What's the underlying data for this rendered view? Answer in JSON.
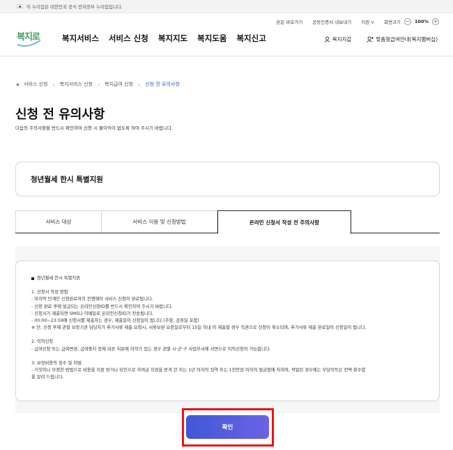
{
  "gov_bar": {
    "text": "이 누리집은 대한민국 공식 전자정부 누리집입니다."
  },
  "utility": {
    "links": [
      "본문 바로가기",
      "공동인증서 내보내기",
      "지원 ∨",
      "화면크기"
    ],
    "zoom_value": "100%",
    "zoom_minus": "−",
    "zoom_plus": "+"
  },
  "logo": {
    "text": "복지로"
  },
  "nav": {
    "items": [
      "복지서비스",
      "서비스 신청",
      "복지지도",
      "복지도움",
      "복지신고"
    ]
  },
  "right_nav": {
    "items": [
      "복지지갑",
      "맞춤형급여안내(복지멤버십)"
    ]
  },
  "breadcrumb": {
    "items": [
      "서비스 신청",
      "복지서비스 신청",
      "복지급여 신청",
      "신청 전 유의사항"
    ]
  },
  "page": {
    "title": "신청 전 유의사항",
    "subtitle": "다음의 주의사항을 반드시 확인하여 신청 시 불이익이 없도록 하여 주시기 바랍니다."
  },
  "service_name": "청년월세 한시 특별지원",
  "tabs": [
    "서비스 대상",
    "서비스 이용 및 신청방법",
    "온라인 신청서 작성 전 주의사항"
  ],
  "notice": {
    "heading": "청년월세 한시 특별지원",
    "sections": [
      {
        "title": "1. 신청서 작성 방법",
        "lines": [
          "- 마지막 단계인 신청완료까지 진행해야 서비스 신청이 완료됩니다.",
          "- 신청 완료 후에 발급되는 온라인신청ID를 반드시 확인하여 주시기 바랍니다.",
          "- 신청서가 제출되면 SMS나 이메일로 온라인신청ID가 전송됩니다.",
          "- 00:00~23:59에 신청서를 제출하는 경우, 제출일이 신청일이 됩니다.(주말, 공휴일 포함)",
          "※ 단, 신청 후에 관할 보장기관 담당자가 추가서류 제출 요청시, 서류보완 요청일로부터 15일 이내 미 제출할 경우 직권으로 신청이 취소되며, 추가서류 제출 완료일이 신청일이 됩니다."
        ]
      },
      {
        "title": "2. 이의신청",
        "lines": [
          "- 급여신청 또는 급여변경, 급여중지 등에 따른 처분에 이의가 있는 경우 관할 시·군·구 사업부서에 서면으로 이의신청이 가능합니다."
        ]
      },
      {
        "title": "3. 보장비용의 징수 및 처벌",
        "lines": [
          "- 거짓이나 부정한 방법으로 비용을 지원 받거나 타인으로 하여금 지원을 받게 한 자는 1년 이하의 징역 또는 1천만원 이하의 벌금형에 처하며, 적발된 경우에는 부당이득은 전액 환수함",
          "을 알려 드립니다."
        ]
      }
    ]
  },
  "confirm_button": "확인",
  "colors": {
    "accent": "#3b5bdb",
    "button_gradient": [
      "#4257d6",
      "#6b63e3"
    ],
    "highlight": "#e11111",
    "logo": "#3c9a5c"
  }
}
